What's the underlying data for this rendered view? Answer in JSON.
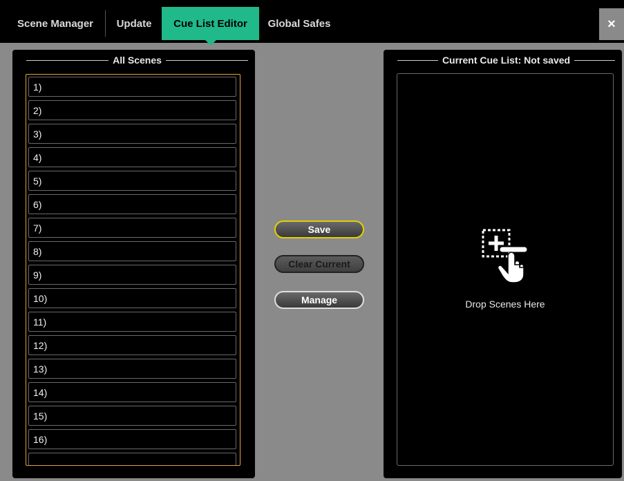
{
  "tabs": [
    {
      "label": "Scene Manager",
      "active": false
    },
    {
      "label": "Update",
      "active": false
    },
    {
      "label": "Cue List Editor",
      "active": true
    },
    {
      "label": "Global Safes",
      "active": false
    }
  ],
  "close_icon": "×",
  "all_scenes": {
    "title": "All Scenes",
    "rows": [
      "1)",
      "2)",
      "3)",
      "4)",
      "5)",
      "6)",
      "7)",
      "8)",
      "9)",
      "10)",
      "11)",
      "12)",
      "13)",
      "14)",
      "15)",
      "16)"
    ]
  },
  "actions": {
    "save_label": "Save",
    "clear_label": "Clear Current",
    "manage_label": "Manage"
  },
  "cue_list": {
    "title": "Current Cue List: Not saved",
    "drop_icon": "add-drag-hand-icon",
    "drop_text": "Drop Scenes Here"
  },
  "colors": {
    "accent": "#1fb98a",
    "save_border": "#e3d000",
    "list_border": "#e8a23a"
  }
}
